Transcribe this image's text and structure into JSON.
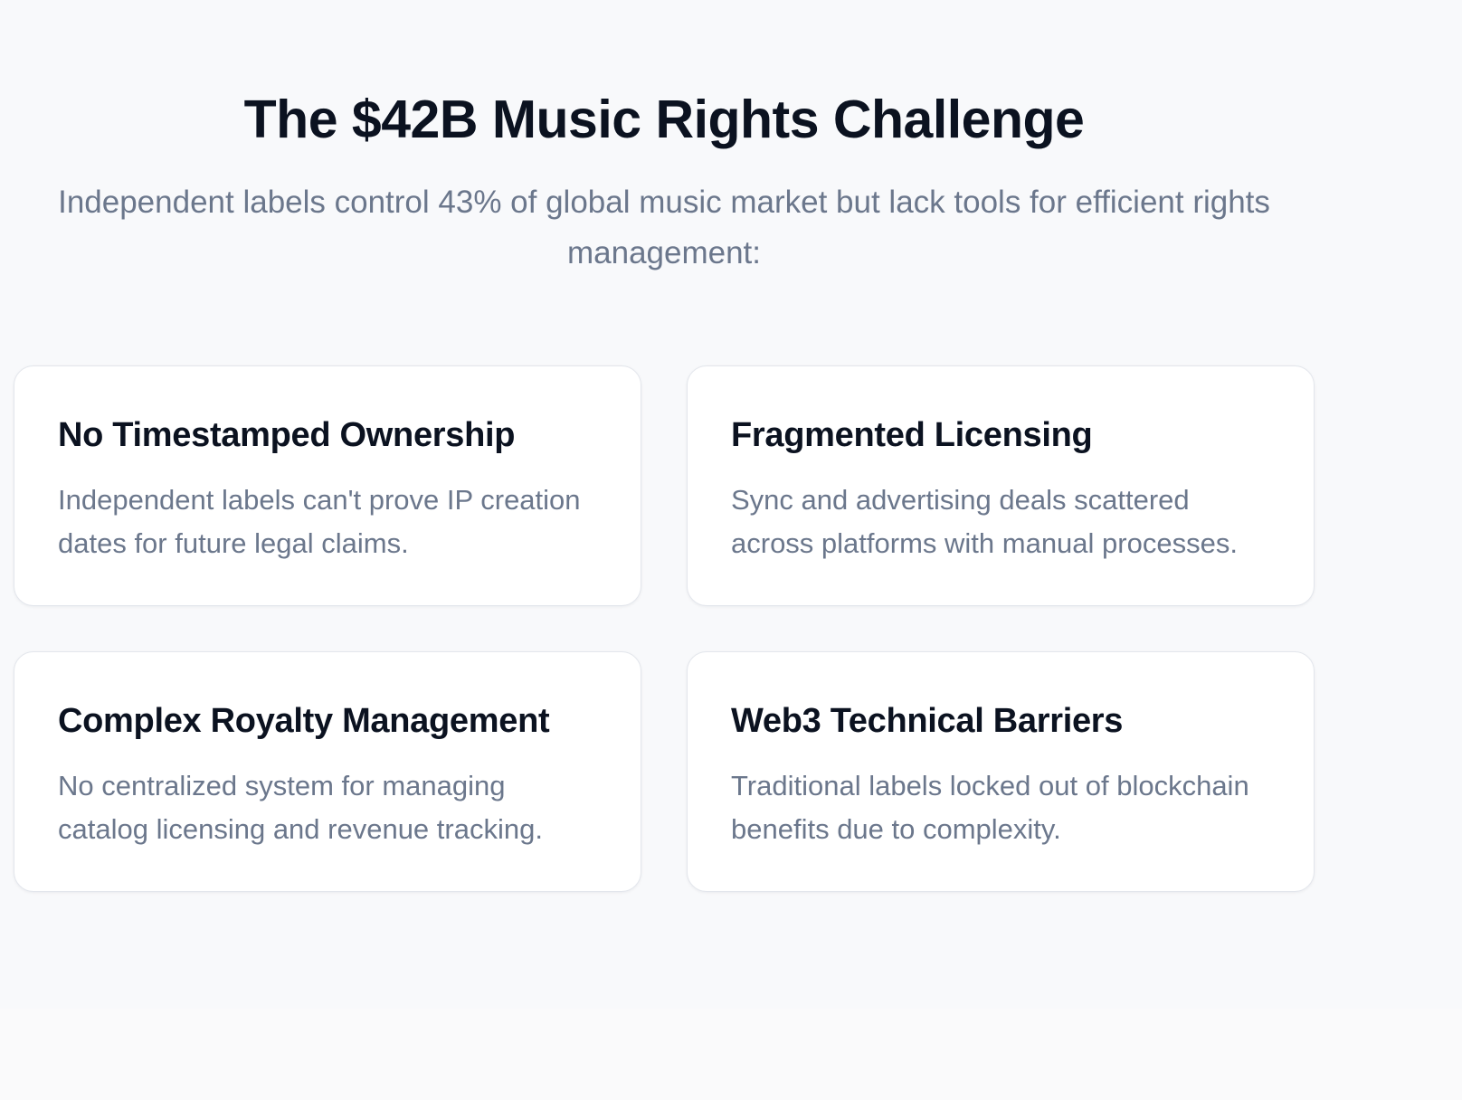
{
  "section": {
    "title": "The $42B Music Rights Challenge",
    "subtitle": "Independent labels control 43% of global music market but lack tools for efficient rights management:"
  },
  "cards": [
    {
      "title": "No Timestamped Ownership",
      "text": "Independent labels can't prove IP creation dates for future legal claims."
    },
    {
      "title": "Fragmented Licensing",
      "text": "Sync and advertising deals scattered across platforms with manual processes."
    },
    {
      "title": "Complex Royalty Management",
      "text": "No centralized system for managing catalog licensing and revenue tracking."
    },
    {
      "title": "Web3 Technical Barriers",
      "text": "Traditional labels locked out of blockchain benefits due to complexity."
    }
  ],
  "colors": {
    "background": "#f8f9fb",
    "heading": "#0b1220",
    "body_text": "#6b778c",
    "card_background": "#ffffff",
    "card_border": "#e3e6ec"
  }
}
